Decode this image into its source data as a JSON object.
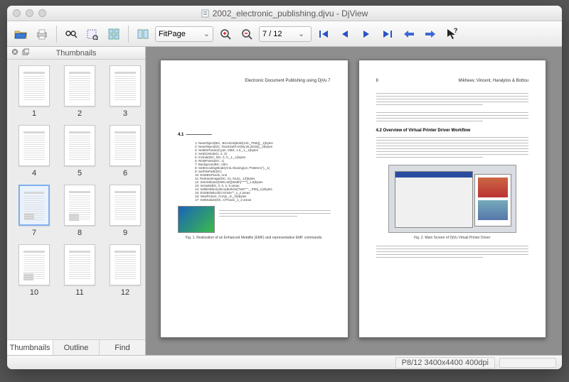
{
  "window": {
    "title": "2002_electronic_publishing.djvu - DjView"
  },
  "toolbar": {
    "zoom_mode": "FitPage",
    "page_field": "7 / 12"
  },
  "sidebar": {
    "heading": "Thumbnails",
    "tabs": {
      "thumbnails": "Thumbnails",
      "outline": "Outline",
      "find": "Find"
    },
    "pages": [
      "1",
      "2",
      "3",
      "4",
      "5",
      "6",
      "7",
      "8",
      "9",
      "10",
      "11",
      "12"
    ],
    "selected_index": 6
  },
  "status": {
    "page_info": "P8/12 3400x4400 400dpi"
  },
  "spread": {
    "left": {
      "running_head": "Electronic Document Publishing using DjVu     7",
      "section_num": "4.1",
      "code": [
        "1: NewObject(BG, JEcnSize[Bold(140,_Pt55)],_1)bytes",
        "2: NewObject(DC, TextSize[Font(W,25,2615)],_2)bytes",
        "3: SetBGParam(Cyan, GBS, 1.0,_1,_1)bytes",
        "4: SetDCMode(1, 2, 3)",
        "5: Include(DC, BG, 0, 0,_1,_1)bytes",
        "6: RGBPixels(DC, 1)",
        "7: BackgroundDc, Attr1",
        "8: SetEncodingMode(Anti,Aliasing(on,\"Pattern1\"),_1)",
        "9: SetFilePath(DC)",
        "10: EmitBGPixels, Anti",
        "11: RedrawImage(DC, 21, NULL, 13)bytes",
        "12: SetAttribute(DWCont[(Width)\"\"\"\"\"]_1,8)bytes",
        "13: Include(BG, 0, 0, 2, 5 areas",
        "14: SetBGBlock(JEcodedSize[\"540\"\"\", _P55]_1)2bytes",
        "15: EmitBGBlock(CATSite\"\"_1_2 areas",
        "16: NewPicture, CoA[x,_9,_15)bytes",
        "17: SetModule(DC, CPCard,_1_2 areas"
      ],
      "caption": "Fig. 1. Realization of an Enhanced Metafile (EMF) and representative EMF commands."
    },
    "right": {
      "running_head_left": "8",
      "running_head_right": "Mikheev, Vincent, Haralytos & Bottou",
      "sec_heading": "4.2   Overview of Virtual Printer Driver Workflow",
      "caption": "Fig. 2. Main Screen of DjVu Virtual Printer Driver"
    }
  }
}
